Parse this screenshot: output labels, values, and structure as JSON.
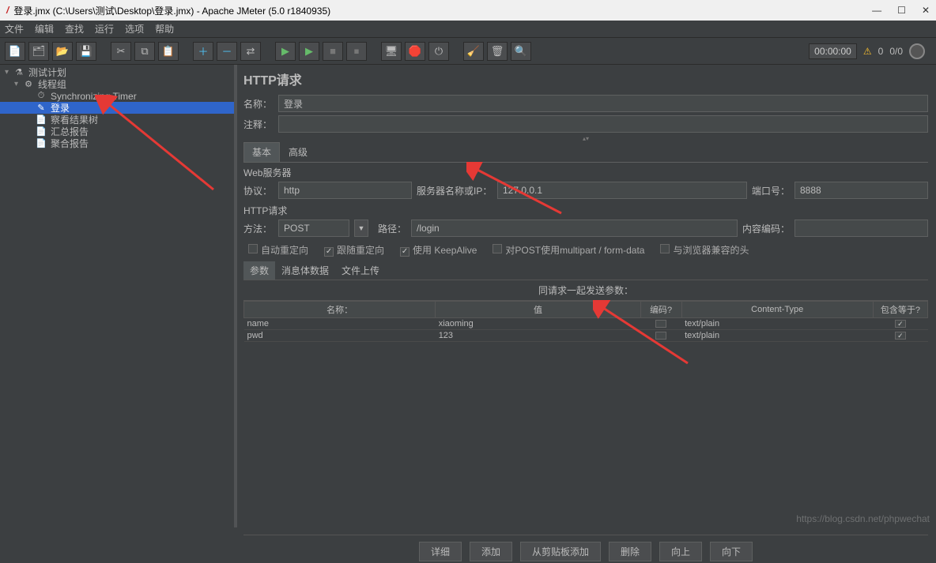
{
  "window": {
    "title": "登录.jmx (C:\\Users\\测试\\Desktop\\登录.jmx) - Apache JMeter (5.0 r1840935)"
  },
  "menu": {
    "items": [
      "文件",
      "编辑",
      "查找",
      "运行",
      "选项",
      "帮助"
    ]
  },
  "status": {
    "timer": "00:00:00",
    "warn_count": "0",
    "threads": "0/0"
  },
  "tree": {
    "items": [
      {
        "label": "测试计划",
        "indent": 0,
        "expanded": true,
        "icon": "⚗",
        "sel": false
      },
      {
        "label": "线程组",
        "indent": 1,
        "expanded": true,
        "icon": "⚙",
        "sel": false
      },
      {
        "label": "Synchronizing Timer",
        "indent": 2,
        "icon": "⏱",
        "sel": false
      },
      {
        "label": "登录",
        "indent": 2,
        "icon": "✎",
        "sel": true
      },
      {
        "label": "察看结果树",
        "indent": 2,
        "icon": "📄",
        "sel": false
      },
      {
        "label": "汇总报告",
        "indent": 2,
        "icon": "📄",
        "sel": false
      },
      {
        "label": "聚合报告",
        "indent": 2,
        "icon": "📄",
        "sel": false
      }
    ]
  },
  "panel": {
    "title": "HTTP请求",
    "name_lbl": "名称：",
    "name_val": "登录",
    "comment_lbl": "注释：",
    "comment_val": "",
    "tab_basic": "基本",
    "tab_advanced": "高级",
    "web_server_lbl": "Web服务器",
    "protocol_lbl": "协议：",
    "protocol_val": "http",
    "server_lbl": "服务器名称或IP：",
    "server_val": "127.0.0.1",
    "port_lbl": "端口号：",
    "port_val": "8888",
    "http_req_lbl": "HTTP请求",
    "method_lbl": "方法：",
    "method_val": "POST",
    "path_lbl": "路径：",
    "path_val": "/login",
    "encoding_lbl": "内容编码：",
    "encoding_val": "",
    "cb_auto": "自动重定向",
    "cb_follow": "跟随重定向",
    "cb_keepalive": "使用 KeepAlive",
    "cb_multipart": "对POST使用multipart / form-data",
    "cb_browser": "与浏览器兼容的头",
    "subtab_params": "参数",
    "subtab_body": "消息体数据",
    "subtab_file": "文件上传",
    "params_title": "同请求一起发送参数：",
    "cols": {
      "name": "名称：",
      "value": "值",
      "encode": "编码?",
      "ctype": "Content-Type",
      "include": "包含等于?"
    },
    "rows": [
      {
        "name": "name",
        "value": "xiaoming",
        "encode": false,
        "ctype": "text/plain",
        "include": true
      },
      {
        "name": "pwd",
        "value": "123",
        "encode": false,
        "ctype": "text/plain",
        "include": true
      }
    ],
    "btns": {
      "detail": "详细",
      "add": "添加",
      "clip": "从剪贴板添加",
      "del": "删除",
      "up": "向上",
      "down": "向下"
    }
  },
  "watermark": "https://blog.csdn.net/phpwechat"
}
